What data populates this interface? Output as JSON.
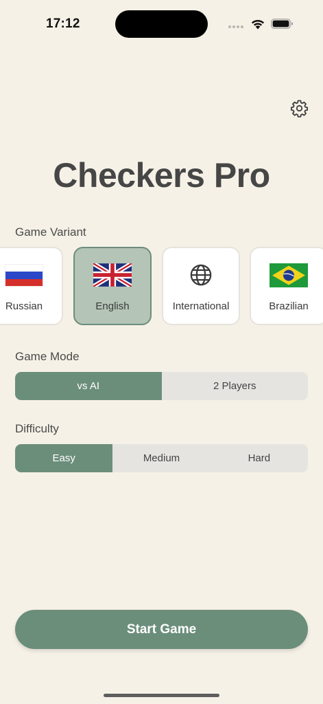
{
  "status_bar": {
    "time": "17:12"
  },
  "app": {
    "title": "Checkers Pro",
    "accent_color": "#6b8e7b",
    "background_color": "#f6f1e7"
  },
  "game_variant": {
    "label": "Game Variant",
    "selected": "English",
    "options": [
      {
        "label": "Russian",
        "icon": "russia-flag-icon"
      },
      {
        "label": "English",
        "icon": "uk-flag-icon"
      },
      {
        "label": "International",
        "icon": "globe-icon"
      },
      {
        "label": "Brazilian",
        "icon": "brazil-flag-icon"
      }
    ]
  },
  "game_mode": {
    "label": "Game Mode",
    "selected": "vs AI",
    "options": [
      "vs AI",
      "2 Players"
    ]
  },
  "difficulty": {
    "label": "Difficulty",
    "selected": "Easy",
    "options": [
      "Easy",
      "Medium",
      "Hard"
    ]
  },
  "start_button": {
    "label": "Start Game"
  }
}
